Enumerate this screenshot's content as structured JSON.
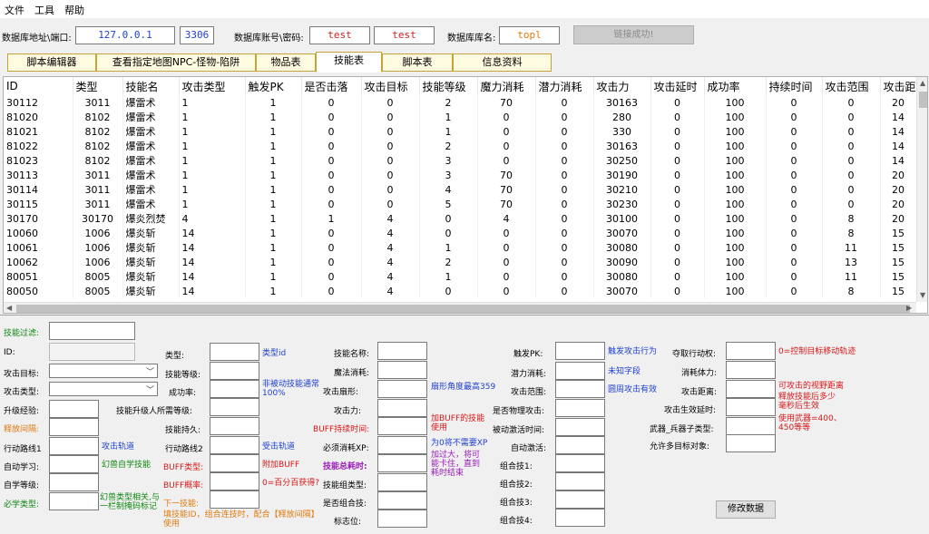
{
  "menu": [
    "文件",
    "工具",
    "帮助"
  ],
  "connection": {
    "address_label": "数据库地址\\端口:",
    "host": "127.0.0.1",
    "port": "3306",
    "account_label": "数据库账号\\密码:",
    "user": "test",
    "password": "test",
    "dbname_label": "数据库库名:",
    "dbname": "topl",
    "connect_button": "链接成功!"
  },
  "tabs": [
    "脚本编辑器",
    "查看指定地图NPC-怪物-陷阱",
    "物品表",
    "技能表",
    "脚本表",
    "信息资料"
  ],
  "active_tab": 3,
  "table": {
    "columns": [
      "ID",
      "类型",
      "技能名",
      "攻击类型",
      "触发PK",
      "是否击落",
      "攻击目标",
      "技能等级",
      "魔力消耗",
      "潜力消耗",
      "攻击力",
      "攻击延时",
      "成功率",
      "持续时间",
      "攻击范围",
      "攻击距"
    ],
    "rows": [
      [
        "30112",
        "3011",
        "爆雷术",
        "1",
        "1",
        "0",
        "0",
        "2",
        "70",
        "0",
        "30163",
        "0",
        "100",
        "0",
        "0",
        "20"
      ],
      [
        "81020",
        "8102",
        "爆雷术",
        "1",
        "1",
        "0",
        "0",
        "1",
        "0",
        "0",
        "280",
        "0",
        "100",
        "0",
        "0",
        "14"
      ],
      [
        "81021",
        "8102",
        "爆雷术",
        "1",
        "1",
        "0",
        "0",
        "1",
        "0",
        "0",
        "330",
        "0",
        "100",
        "0",
        "0",
        "14"
      ],
      [
        "81022",
        "8102",
        "爆雷术",
        "1",
        "1",
        "0",
        "0",
        "2",
        "0",
        "0",
        "30163",
        "0",
        "100",
        "0",
        "0",
        "14"
      ],
      [
        "81023",
        "8102",
        "爆雷术",
        "1",
        "1",
        "0",
        "0",
        "3",
        "0",
        "0",
        "30250",
        "0",
        "100",
        "0",
        "0",
        "14"
      ],
      [
        "30113",
        "3011",
        "爆雷术",
        "1",
        "1",
        "0",
        "0",
        "3",
        "70",
        "0",
        "30190",
        "0",
        "100",
        "0",
        "0",
        "20"
      ],
      [
        "30114",
        "3011",
        "爆雷术",
        "1",
        "1",
        "0",
        "0",
        "4",
        "70",
        "0",
        "30210",
        "0",
        "100",
        "0",
        "0",
        "20"
      ],
      [
        "30115",
        "3011",
        "爆雷术",
        "1",
        "1",
        "0",
        "0",
        "5",
        "70",
        "0",
        "30230",
        "0",
        "100",
        "0",
        "0",
        "20"
      ],
      [
        "30170",
        "30170",
        "爆炎烈焚",
        "4",
        "1",
        "1",
        "4",
        "0",
        "4",
        "0",
        "30100",
        "0",
        "100",
        "0",
        "8",
        "20"
      ],
      [
        "10060",
        "1006",
        "爆炎斩",
        "14",
        "1",
        "0",
        "4",
        "0",
        "0",
        "0",
        "30070",
        "0",
        "100",
        "0",
        "8",
        "15"
      ],
      [
        "10061",
        "1006",
        "爆炎斩",
        "14",
        "1",
        "0",
        "4",
        "1",
        "0",
        "0",
        "30080",
        "0",
        "100",
        "0",
        "11",
        "15"
      ],
      [
        "10062",
        "1006",
        "爆炎斩",
        "14",
        "1",
        "0",
        "4",
        "2",
        "0",
        "0",
        "30090",
        "0",
        "100",
        "0",
        "13",
        "15"
      ],
      [
        "80051",
        "8005",
        "爆炎斩",
        "14",
        "1",
        "0",
        "4",
        "1",
        "0",
        "0",
        "30080",
        "0",
        "100",
        "0",
        "11",
        "15"
      ],
      [
        "80050",
        "8005",
        "爆炎斩",
        "14",
        "1",
        "0",
        "4",
        "0",
        "0",
        "0",
        "30070",
        "0",
        "100",
        "0",
        "8",
        "15"
      ]
    ]
  },
  "form": {
    "filter_label": "技能过滤:",
    "id_label": "ID:",
    "target_label": "攻击目标:",
    "attack_type_label": "攻击类型:",
    "upgrade_exp_label": "升级经验:",
    "release_interval_label": "释放间隔:",
    "path1_label": "行动路线1",
    "path1_note": "攻击轨道",
    "auto_learn_label": "自动学习:",
    "auto_learn_note": "幻兽自学技能",
    "learn_level_label": "自学等级:",
    "must_learn_label": "必学类型:",
    "must_learn_note": "幻兽类型相关,与一栏制掩码标记",
    "type_label": "类型:",
    "type_note": "类型id",
    "skill_level_label": "技能等级:",
    "success_label": "成功率:",
    "success_note": "非被动技能通常100%",
    "req_level_label": "技能升级人所需等级:",
    "duration_label": "技能持久:",
    "path2_label": "行动路线2",
    "path2_note": "受击轨道",
    "buff_type_label": "BUFF类型:",
    "buff_type_note": "附加BUFF",
    "buff_rate_label": "BUFF概率:",
    "buff_rate_note": "0=百分百获得?",
    "next_skill_label": "下一技能:",
    "next_skill_note": "填技能ID，组合连技时，配合【释放间隔】使用",
    "skill_name_label": "技能名称:",
    "mana_label": "魔法消耗:",
    "shape_label": "攻击扇形:",
    "shape_note": "扇形角度最高359",
    "power_label": "攻击力:",
    "buff_time_label": "BUFF持续时间:",
    "buff_time_note": "加BUFF的技能使用",
    "xp_label": "必须消耗XP:",
    "xp_note": "为0将不需要XP",
    "total_time_label": "技能总耗时:",
    "total_time_note": "加过大，将可能卡住，直到耗时结束",
    "group_type_label": "技能组类型:",
    "is_group_label": "是否组合技:",
    "flag_label": "标志位:",
    "trigger_pk_label": "触发PK:",
    "trigger_pk_note": "触发攻击行为",
    "potential_label": "潜力消耗:",
    "potential_note": "未知字段",
    "range_label": "攻击范围:",
    "range_note": "圆周攻击有效",
    "physical_label": "是否物理攻击:",
    "passive_label": "被动激活时间:",
    "auto_label": "自动激活:",
    "combo1_label": "组合技1:",
    "combo2_label": "组合技2:",
    "combo3_label": "组合技3:",
    "combo4_label": "组合技4:",
    "seize_label": "夺取行动权:",
    "seize_note": "0=控制目标移动轨迹",
    "stamina_label": "消耗体力:",
    "distance_label": "攻击距离:",
    "distance_note": "可攻击的视野距离",
    "delay_label": "攻击生效延时:",
    "delay_note": "释放技能后多少毫秒后生效",
    "weapon_label": "武器_兵器子类型:",
    "weapon_note": "使用武器=400、450等等",
    "multi_label": "允许多目标对象:",
    "save_button": "修改数据"
  }
}
